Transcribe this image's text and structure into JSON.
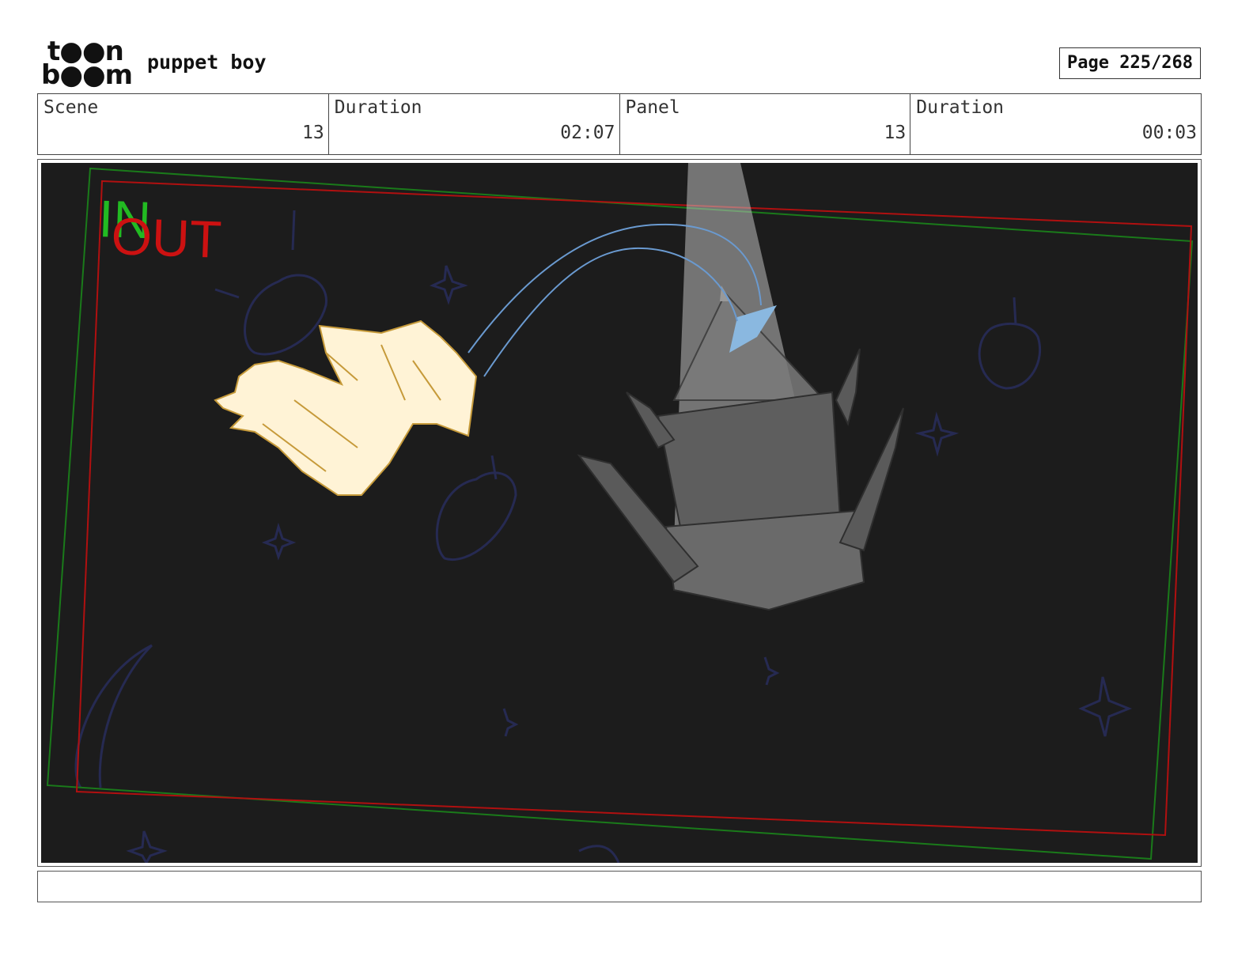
{
  "header": {
    "logo_line1": "t●●n",
    "logo_line2": "b●●m",
    "project_title": "puppet boy",
    "page_label": "Page 225/268"
  },
  "info": {
    "scene_label": "Scene",
    "scene_value": "13",
    "scene_duration_label": "Duration",
    "scene_duration_value": "02:07",
    "panel_label": "Panel",
    "panel_value": "13",
    "panel_duration_label": "Duration",
    "panel_duration_value": "00:03"
  },
  "panel": {
    "in_label": "IN",
    "out_label": "OUT",
    "in_color": "#22bb22",
    "out_color": "#cc1111",
    "background_color": "#1c1c1c"
  },
  "notes": {
    "text": ""
  }
}
